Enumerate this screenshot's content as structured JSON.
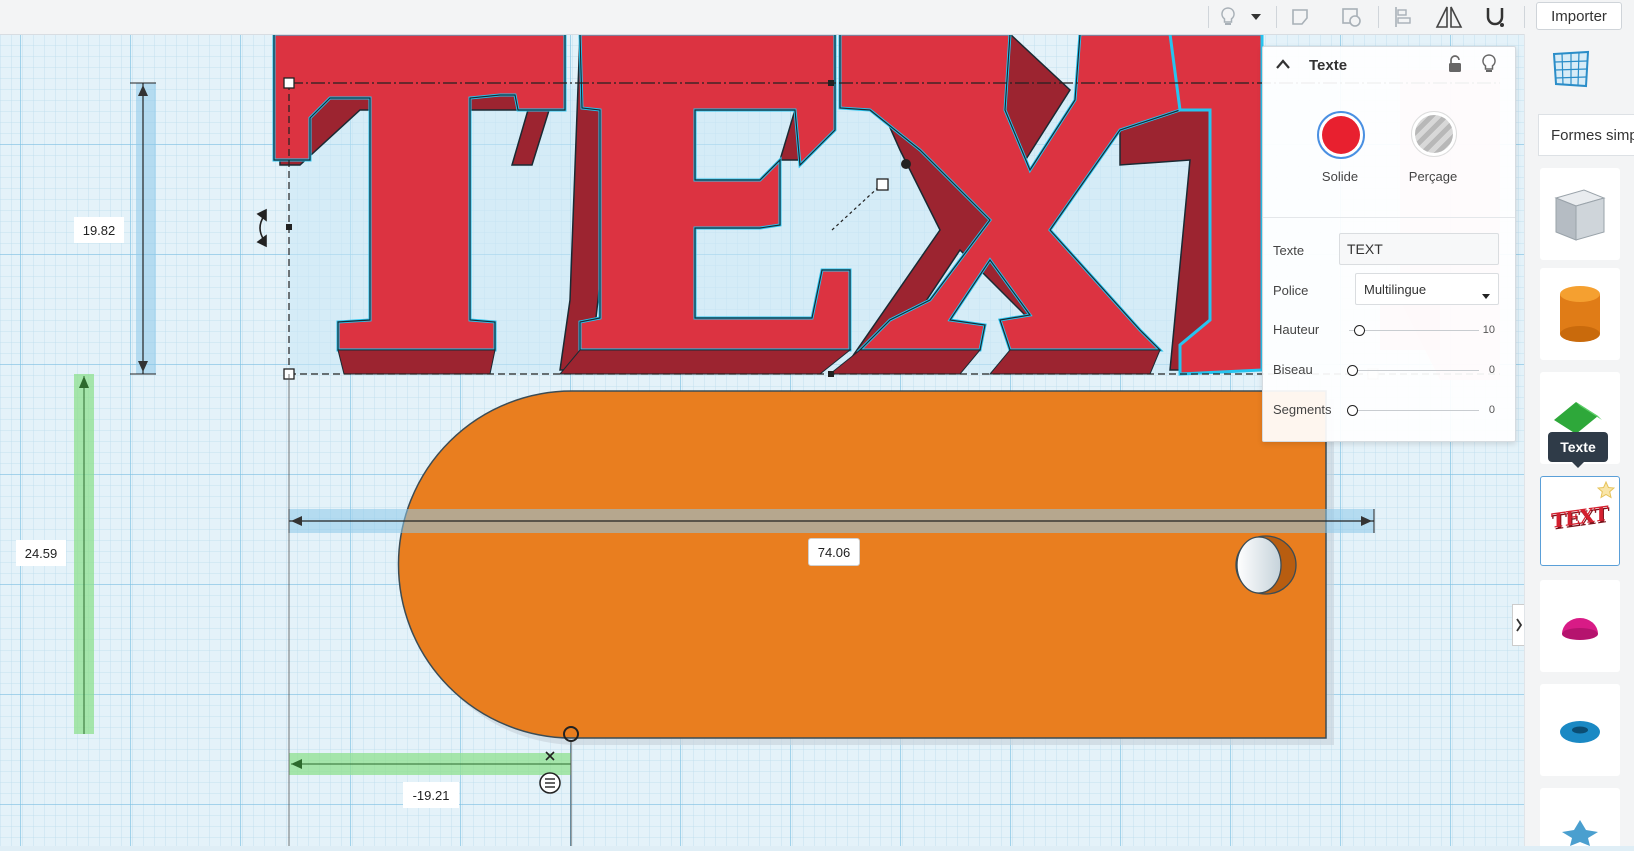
{
  "toolbar": {
    "import_label": "Importer",
    "icons": [
      "lightbulb-icon",
      "chevron-down-icon",
      "shape-note-icon",
      "shape-view-icon",
      "align-icon",
      "mirror-icon",
      "magnet-icon"
    ]
  },
  "dimensions": {
    "height": "19.82",
    "elevation": "24.59",
    "width": "74.06",
    "offset": "-19.21"
  },
  "shape_panel": {
    "title": "Texte",
    "solid_label": "Solide",
    "hole_label": "Perçage",
    "text_label": "Texte",
    "text_value": "TEXT",
    "font_label": "Police",
    "font_value": "Multilingue",
    "height_label": "Hauteur",
    "height_value": "10",
    "height_level": 0.05,
    "bevel_label": "Biseau",
    "bevel_value": "0",
    "bevel_level": 0,
    "segments_label": "Segments",
    "segments_value": "0",
    "segments_level": 0,
    "solid_color": "#e8202f",
    "icons": [
      "chevron-up-icon",
      "lock-icon",
      "lightbulb-icon"
    ]
  },
  "sidebar": {
    "category_label": "Formes simp",
    "tooltip": "Texte",
    "selected_item_text": "TEXT",
    "items": [
      "box",
      "cylinder",
      "roof",
      "text",
      "half-sphere",
      "torus",
      "star"
    ]
  },
  "scene": {
    "text_letters": "TEXT",
    "text_color": "#db3341",
    "base_color": "#e97e1f",
    "selection_color": "#27c4ef"
  },
  "colors": {
    "grid_bg": "#dfeef6",
    "grid_line": "#b7d8ea",
    "dim_blue": "#8cc8ea",
    "dim_green": "#8fe08f"
  }
}
